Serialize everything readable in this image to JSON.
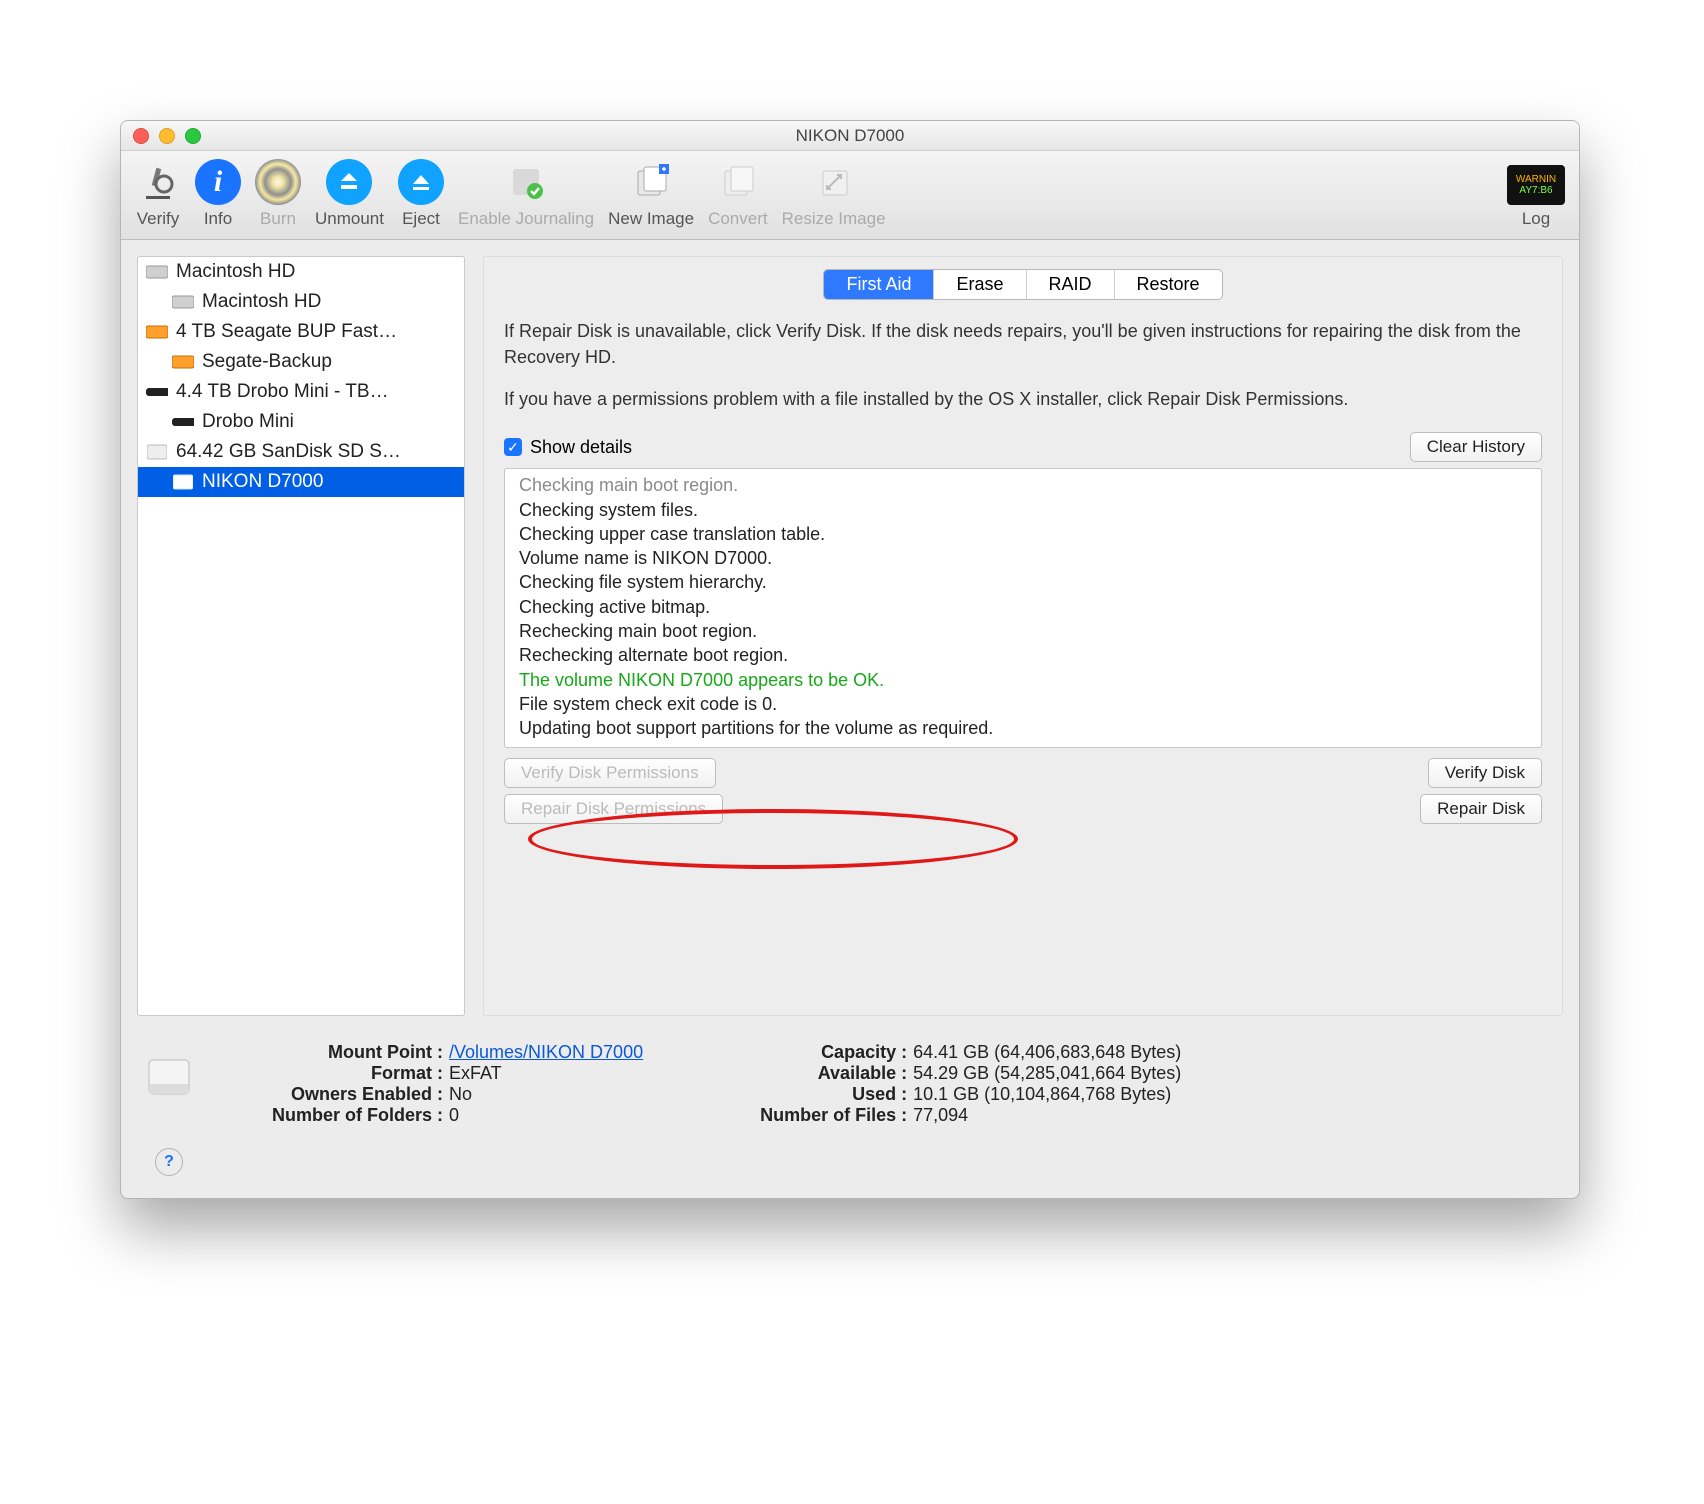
{
  "window_title": "NIKON D7000",
  "toolbar": {
    "verify": "Verify",
    "info": "Info",
    "burn": "Burn",
    "unmount": "Unmount",
    "eject": "Eject",
    "enable_journaling": "Enable Journaling",
    "new_image": "New Image",
    "convert": "Convert",
    "resize_image": "Resize Image",
    "log": "Log"
  },
  "sidebar": {
    "items": [
      {
        "label": "Macintosh HD",
        "type": "disk"
      },
      {
        "label": "Macintosh HD",
        "type": "vol",
        "indent": true
      },
      {
        "label": "4 TB Seagate BUP Fast…",
        "type": "ext-orange"
      },
      {
        "label": "Segate-Backup",
        "type": "ext-orange-vol",
        "indent": true
      },
      {
        "label": "4.4 TB Drobo Mini - TB…",
        "type": "drobo"
      },
      {
        "label": "Drobo Mini",
        "type": "drobo-vol",
        "indent": true
      },
      {
        "label": "64.42 GB SanDisk SD S…",
        "type": "sd"
      },
      {
        "label": "NIKON D7000",
        "type": "sd-vol",
        "indent": true,
        "selected": true
      }
    ]
  },
  "tabs": {
    "first_aid": "First Aid",
    "erase": "Erase",
    "raid": "RAID",
    "restore": "Restore"
  },
  "instructions": {
    "p1": "If Repair Disk is unavailable, click Verify Disk. If the disk needs repairs, you'll be given instructions for repairing the disk from the Recovery HD.",
    "p2": "If you have a permissions problem with a file installed by the OS X installer, click Repair Disk Permissions."
  },
  "show_details": "Show details",
  "clear_history": "Clear History",
  "log": {
    "l0": "Checking main boot region.",
    "l1": "Checking system files.",
    "l2": "Checking upper case translation table.",
    "l3": "Volume name is NIKON D7000.",
    "l4": "Checking file system hierarchy.",
    "l5": "Checking active bitmap.",
    "l6": "Rechecking main boot region.",
    "l7": "Rechecking alternate boot region.",
    "l8": "The volume NIKON D7000 appears to be OK.",
    "l9": "File system check exit code is 0.",
    "l10": "Updating boot support partitions for the volume as required."
  },
  "buttons": {
    "verify_perm": "Verify Disk Permissions",
    "repair_perm": "Repair Disk Permissions",
    "verify_disk": "Verify Disk",
    "repair_disk": "Repair Disk"
  },
  "info": {
    "mount_point_label": "Mount Point :",
    "mount_point": "/Volumes/NIKON D7000",
    "format_label": "Format :",
    "format": "ExFAT",
    "owners_label": "Owners Enabled :",
    "owners": "No",
    "folders_label": "Number of Folders :",
    "folders": "0",
    "capacity_label": "Capacity :",
    "capacity": "64.41 GB (64,406,683,648 Bytes)",
    "available_label": "Available :",
    "available": "54.29 GB (54,285,041,664 Bytes)",
    "used_label": "Used :",
    "used": "10.1 GB (10,104,864,768 Bytes)",
    "files_label": "Number of Files :",
    "files": "77,094"
  },
  "log_badge": {
    "line1": "WARNIN",
    "line2": "AY7:B6"
  }
}
